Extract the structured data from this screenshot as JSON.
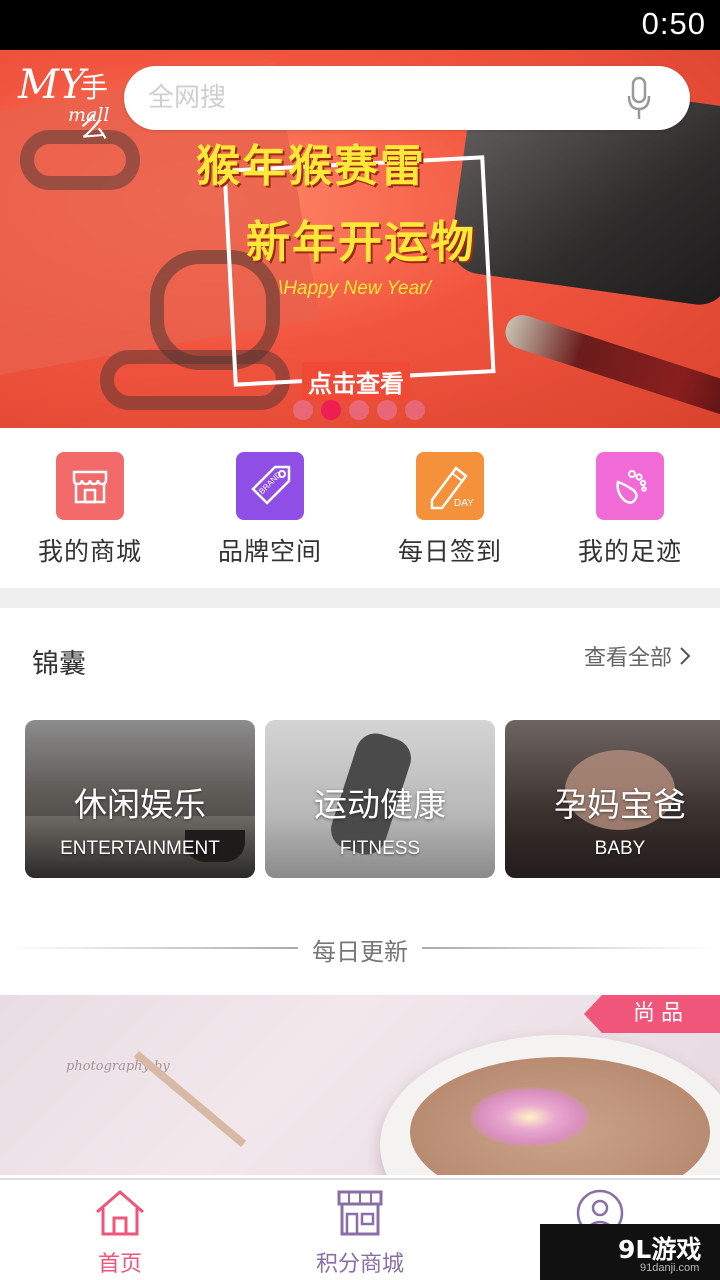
{
  "status_bar": {
    "time": "0:50"
  },
  "header": {
    "logo_my": "MY",
    "logo_zi": "手么",
    "logo_mall": "mall",
    "search_placeholder": "全网搜",
    "mic_icon": "microphone-icon"
  },
  "banner": {
    "line1": "猴年猴赛雷",
    "line2": "新年开运物",
    "line3": "\\Happy New Year/",
    "cta": "点击查看",
    "page_count": 5,
    "active_page": 2
  },
  "quick_links": [
    {
      "label": "我的商城",
      "icon": "store-icon",
      "color": "#f26a6a"
    },
    {
      "label": "品牌空间",
      "icon": "brand-tag-icon",
      "color": "#8f4fe6"
    },
    {
      "label": "每日签到",
      "icon": "pencil-day-icon",
      "color": "#f5913a"
    },
    {
      "label": "我的足迹",
      "icon": "footprint-icon",
      "color": "#f06bd6"
    }
  ],
  "tips": {
    "title": "锦囊",
    "view_all": "查看全部",
    "cards": [
      {
        "cn": "休闲娱乐",
        "en": "ENTERTAINMENT"
      },
      {
        "cn": "运动健康",
        "en": "FITNESS"
      },
      {
        "cn": "孕妈宝爸",
        "en": "BABY"
      }
    ]
  },
  "daily": {
    "title": "每日更新",
    "tag": "尚品",
    "photo_text": "photography by"
  },
  "bottom_nav": [
    {
      "label": "首页",
      "icon": "home-icon",
      "active": true
    },
    {
      "label": "积分商城",
      "icon": "shop-icon",
      "active": false
    },
    {
      "label": "",
      "icon": "profile-icon",
      "active": false
    }
  ],
  "watermark": {
    "text": "9L游戏",
    "url": "91danji.com"
  },
  "colors": {
    "accent": "#f0557a",
    "active_nav": "#f0557a",
    "inactive_nav": "#8a6fa6"
  }
}
